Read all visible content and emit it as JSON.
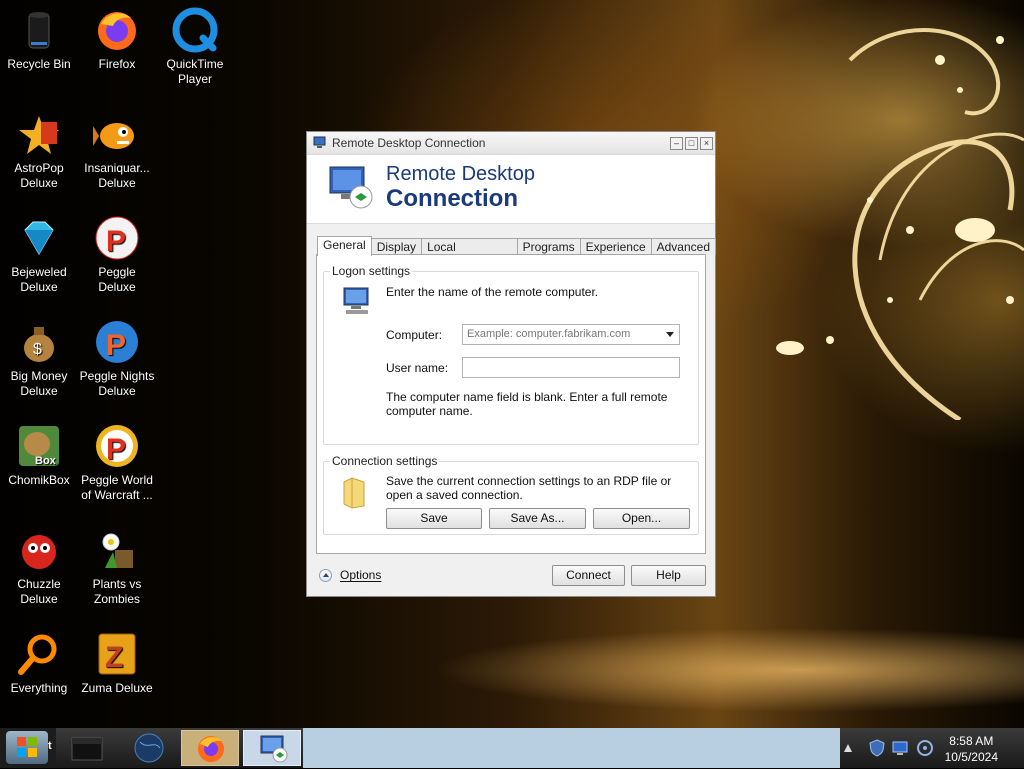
{
  "desktop_icons": [
    {
      "label": "Recycle Bin",
      "icon": "recycle-bin-icon"
    },
    {
      "label": "Firefox",
      "icon": "firefox-icon"
    },
    {
      "label": "QuickTime Player",
      "icon": "quicktime-icon"
    },
    {
      "label": "AstroPop Deluxe",
      "icon": "astropop-icon"
    },
    {
      "label": "Insaniquar... Deluxe",
      "icon": "insaniquarium-icon"
    },
    {
      "label": "Bejeweled Deluxe",
      "icon": "bejeweled-icon"
    },
    {
      "label": "Peggle Deluxe",
      "icon": "peggle-icon"
    },
    {
      "label": "Big Money Deluxe",
      "icon": "big-money-icon"
    },
    {
      "label": "Peggle Nights Deluxe",
      "icon": "peggle-nights-icon"
    },
    {
      "label": "ChomikBox",
      "icon": "chomikbox-icon"
    },
    {
      "label": "Peggle World of Warcraft ...",
      "icon": "peggle-wow-icon"
    },
    {
      "label": "Chuzzle Deluxe",
      "icon": "chuzzle-icon"
    },
    {
      "label": "Plants vs Zombies",
      "icon": "plants-vs-zombies-icon"
    },
    {
      "label": "Everything",
      "icon": "everything-search-icon"
    },
    {
      "label": "Zuma Deluxe",
      "icon": "zuma-icon"
    }
  ],
  "window": {
    "title": "Remote Desktop Connection",
    "banner_line1": "Remote Desktop",
    "banner_line2": "Connection",
    "tabs": [
      "General",
      "Display",
      "Local Resources",
      "Programs",
      "Experience",
      "Advanced"
    ],
    "active_tab": "General",
    "logon": {
      "title": "Logon settings",
      "instruction": "Enter the name of the remote computer.",
      "computer_label": "Computer:",
      "computer_placeholder": "Example: computer.fabrikam.com",
      "username_label": "User name:",
      "username_value": "",
      "blank_notice": "The computer name field is blank. Enter a full remote computer name."
    },
    "connection": {
      "title": "Connection settings",
      "description": "Save the current connection settings to an RDP file or open a saved connection.",
      "save": "Save",
      "save_as": "Save As...",
      "open": "Open..."
    },
    "options_label": "Options",
    "connect_label": "Connect",
    "help_label": "Help"
  },
  "taskbar": {
    "start_suffix": "t",
    "time": "8:58 AM",
    "date": "10/5/2024"
  }
}
